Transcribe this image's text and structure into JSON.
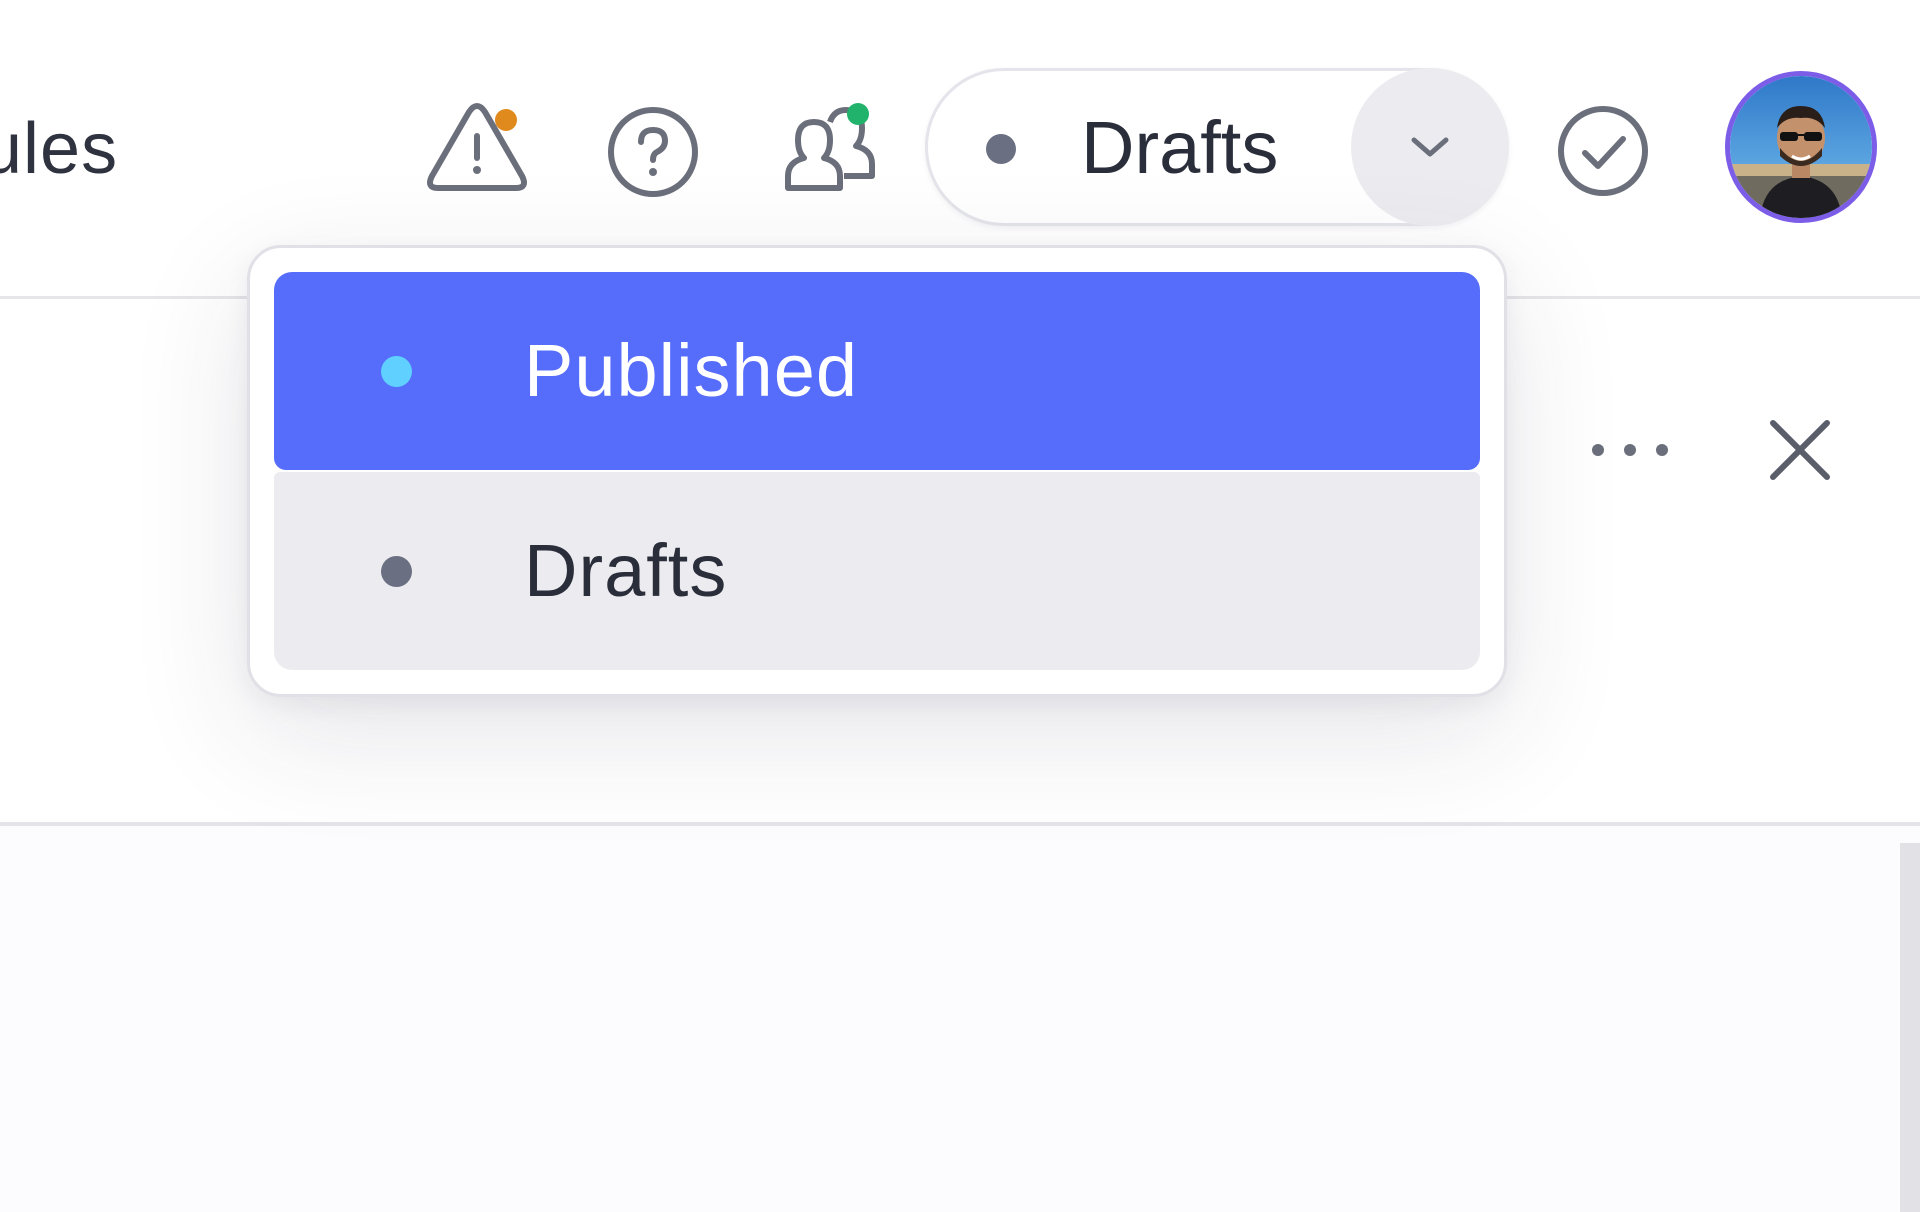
{
  "header": {
    "section_title": "ules",
    "icons": {
      "alert": "warning-triangle-icon",
      "help": "help-circle-icon",
      "collaborators": "users-icon",
      "confirm": "check-circle-icon"
    },
    "indicator_colors": {
      "alert": "#e08a1e",
      "collaborators": "#21b36b"
    },
    "status_select": {
      "value": "Drafts",
      "dot_color": "#6b6f82"
    },
    "avatar_ring_color": "#7c5de8"
  },
  "panel": {
    "icons": {
      "more": "more-horizontal-icon",
      "close": "close-icon"
    }
  },
  "dropdown": {
    "options": [
      {
        "label": "Published",
        "dot_color": "#5fd0ff",
        "state": "selected"
      },
      {
        "label": "Drafts",
        "dot_color": "#6b6f82",
        "state": "hovered"
      }
    ],
    "selected_bg": "#566cfb",
    "hover_bg": "#ececf0"
  }
}
